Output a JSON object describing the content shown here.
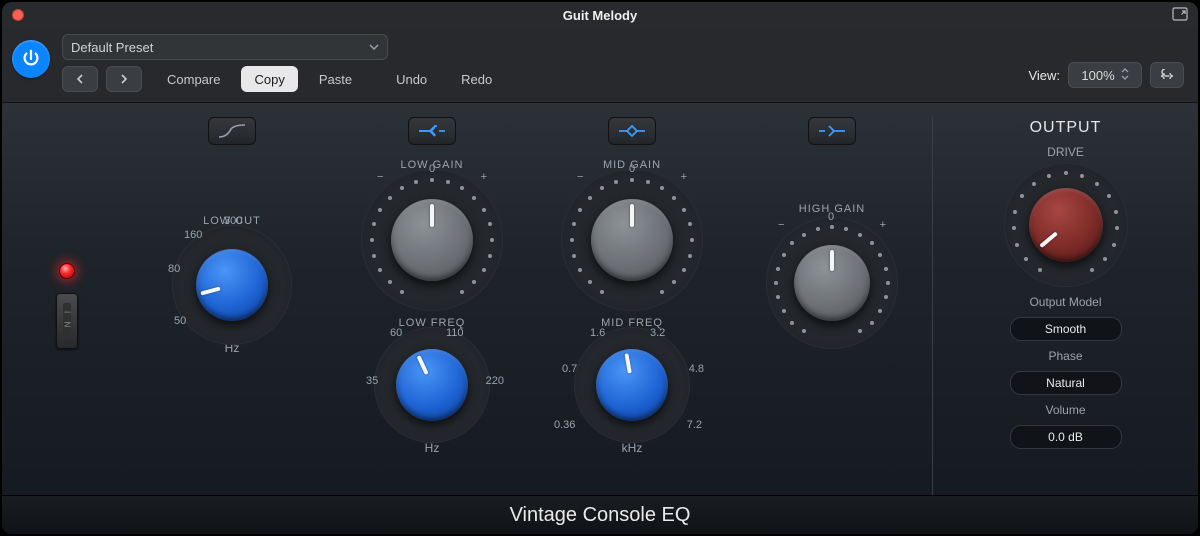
{
  "window": {
    "title": "Guit Melody"
  },
  "toolbar": {
    "preset": "Default Preset",
    "compare": "Compare",
    "copy": "Copy",
    "paste": "Paste",
    "undo": "Undo",
    "redo": "Redo",
    "view_label": "View:",
    "view_value": "100%"
  },
  "sections": {
    "lowcut": {
      "label": "LOW CUT",
      "unit": "Hz",
      "ticks": [
        "50",
        "80",
        "160",
        "300"
      ]
    },
    "low": {
      "gain_label": "LOW GAIN",
      "gain_minus": "−",
      "gain_zero": "0",
      "gain_plus": "+",
      "freq_label": "LOW FREQ",
      "freq_unit": "Hz",
      "freq_ticks": [
        "35",
        "60",
        "110",
        "220"
      ]
    },
    "mid": {
      "gain_label": "MID GAIN",
      "gain_minus": "−",
      "gain_zero": "0",
      "gain_plus": "+",
      "freq_label": "MID FREQ",
      "freq_unit": "kHz",
      "freq_ticks": [
        "0.36",
        "0.7",
        "1.6",
        "3.2",
        "4.8",
        "7.2"
      ]
    },
    "high": {
      "gain_label": "HIGH GAIN",
      "gain_minus": "−",
      "gain_zero": "0",
      "gain_plus": "+"
    }
  },
  "output": {
    "title": "OUTPUT",
    "drive_label": "DRIVE",
    "model_label": "Output Model",
    "model_value": "Smooth",
    "phase_label": "Phase",
    "phase_value": "Natural",
    "volume_label": "Volume",
    "volume_value": "0.0 dB"
  },
  "footer": {
    "title": "Vintage Console EQ"
  },
  "icons": {
    "hp": "highpass-icon",
    "lowshelf": "lowshelf-icon",
    "bell": "bell-icon",
    "highshelf": "highshelf-icon",
    "link": "link-icon",
    "power": "power-icon",
    "fullscreen": "fullscreen-icon"
  },
  "colors": {
    "accent": "#0a84ff",
    "knob_blue": "#1e63d4",
    "knob_red": "#7d2b28",
    "led": "#ff2a2a"
  }
}
